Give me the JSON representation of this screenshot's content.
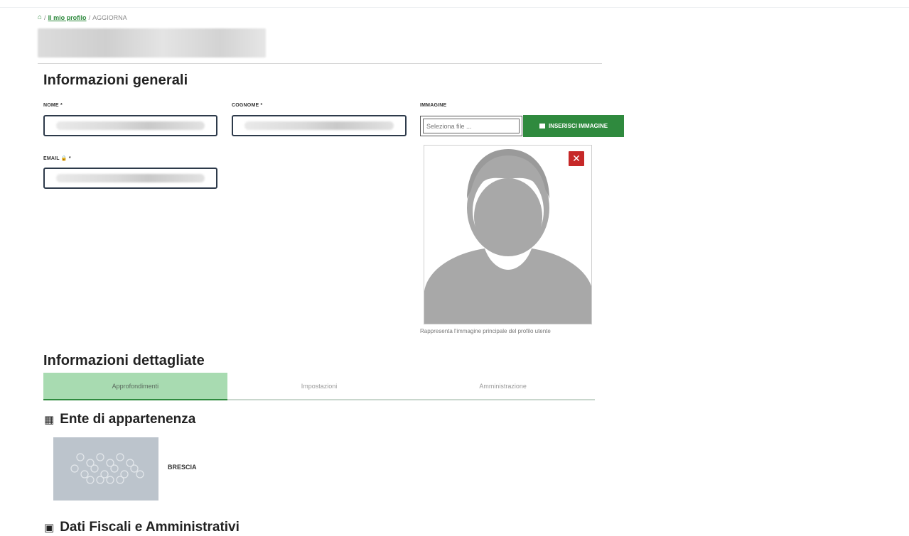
{
  "breadcrumb": {
    "home_icon": "home-icon",
    "link": "Il mio profilo",
    "current": "AGGIORNA",
    "separator": "/"
  },
  "general": {
    "title": "Informazioni generali",
    "nome_label": "NOME *",
    "cognome_label": "COGNOME *",
    "email_label": "EMAIL",
    "email_required": "*",
    "immagine_label": "IMMAGINE",
    "file_placeholder": "Seleziona file ...",
    "insert_button": "INSERISCI IMMAGINE",
    "remove_button": "✕",
    "image_caption": "Rappresenta l'immagine principale del profilo utente"
  },
  "detailed": {
    "title": "Informazioni dettagliate",
    "tabs": [
      {
        "label": "Approfondimenti",
        "active": true
      },
      {
        "label": "Impostazioni",
        "active": false
      },
      {
        "label": "Amministrazione",
        "active": false
      }
    ]
  },
  "ente": {
    "title": "Ente di appartenenza",
    "name": "BRESCIA"
  },
  "fiscal": {
    "title": "Dati Fiscali e Amministrativi"
  },
  "colors": {
    "accent": "#2f8a3e",
    "tab_active": "#a8dbb1",
    "danger": "#c62828"
  }
}
